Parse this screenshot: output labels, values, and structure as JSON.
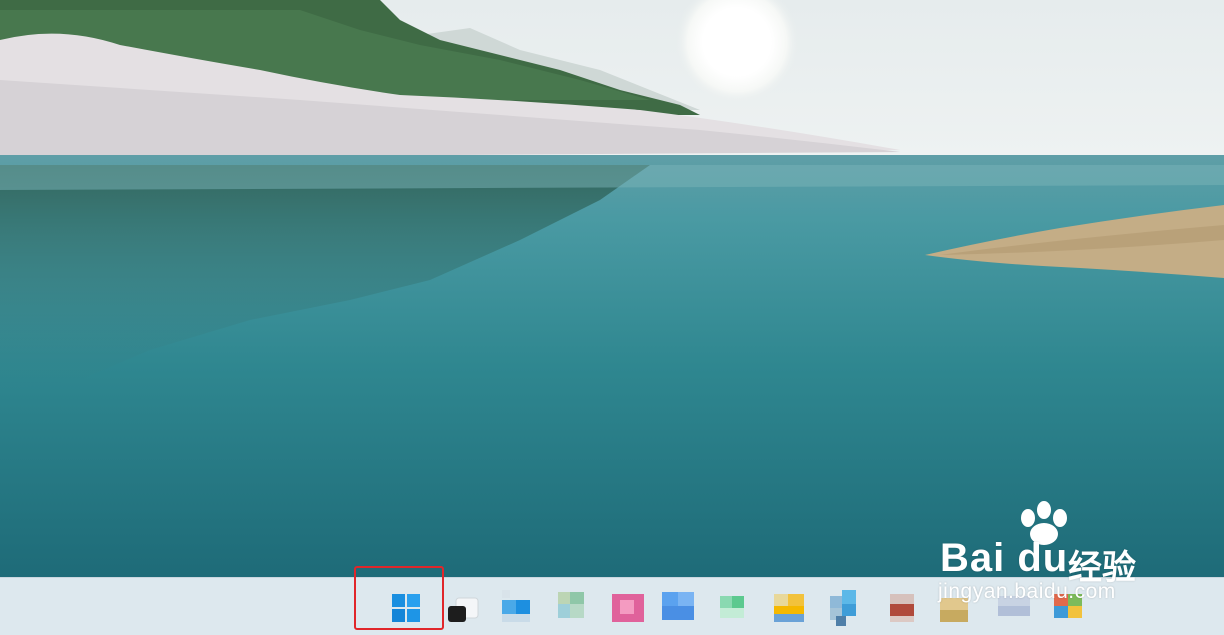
{
  "desktop": {
    "wallpaper": "lake-landscape-wallpaper"
  },
  "taskbar": {
    "start_icon": "windows-start-icon",
    "items": [
      {
        "name": "task-view-button",
        "icon": "task-view-icon"
      },
      {
        "name": "taskbar-app-1",
        "icon": "app-icon-blurred"
      },
      {
        "name": "taskbar-app-2",
        "icon": "app-icon-blurred"
      },
      {
        "name": "taskbar-app-3",
        "icon": "app-icon-blurred"
      },
      {
        "name": "taskbar-app-4",
        "icon": "app-icon-blurred"
      },
      {
        "name": "taskbar-app-5",
        "icon": "app-icon-blurred"
      },
      {
        "name": "taskbar-app-6",
        "icon": "app-icon-blurred"
      },
      {
        "name": "taskbar-app-7",
        "icon": "app-icon-blurred"
      },
      {
        "name": "taskbar-app-8",
        "icon": "app-icon-blurred"
      },
      {
        "name": "taskbar-app-9",
        "icon": "app-icon-blurred"
      },
      {
        "name": "taskbar-app-10",
        "icon": "app-icon-blurred"
      },
      {
        "name": "taskbar-app-11",
        "icon": "app-icon-blurred"
      }
    ],
    "highlight_color": "#e0262a"
  },
  "watermark": {
    "brand": "Bai du",
    "cn": "经验",
    "url": "jingyan.baidu.com"
  }
}
